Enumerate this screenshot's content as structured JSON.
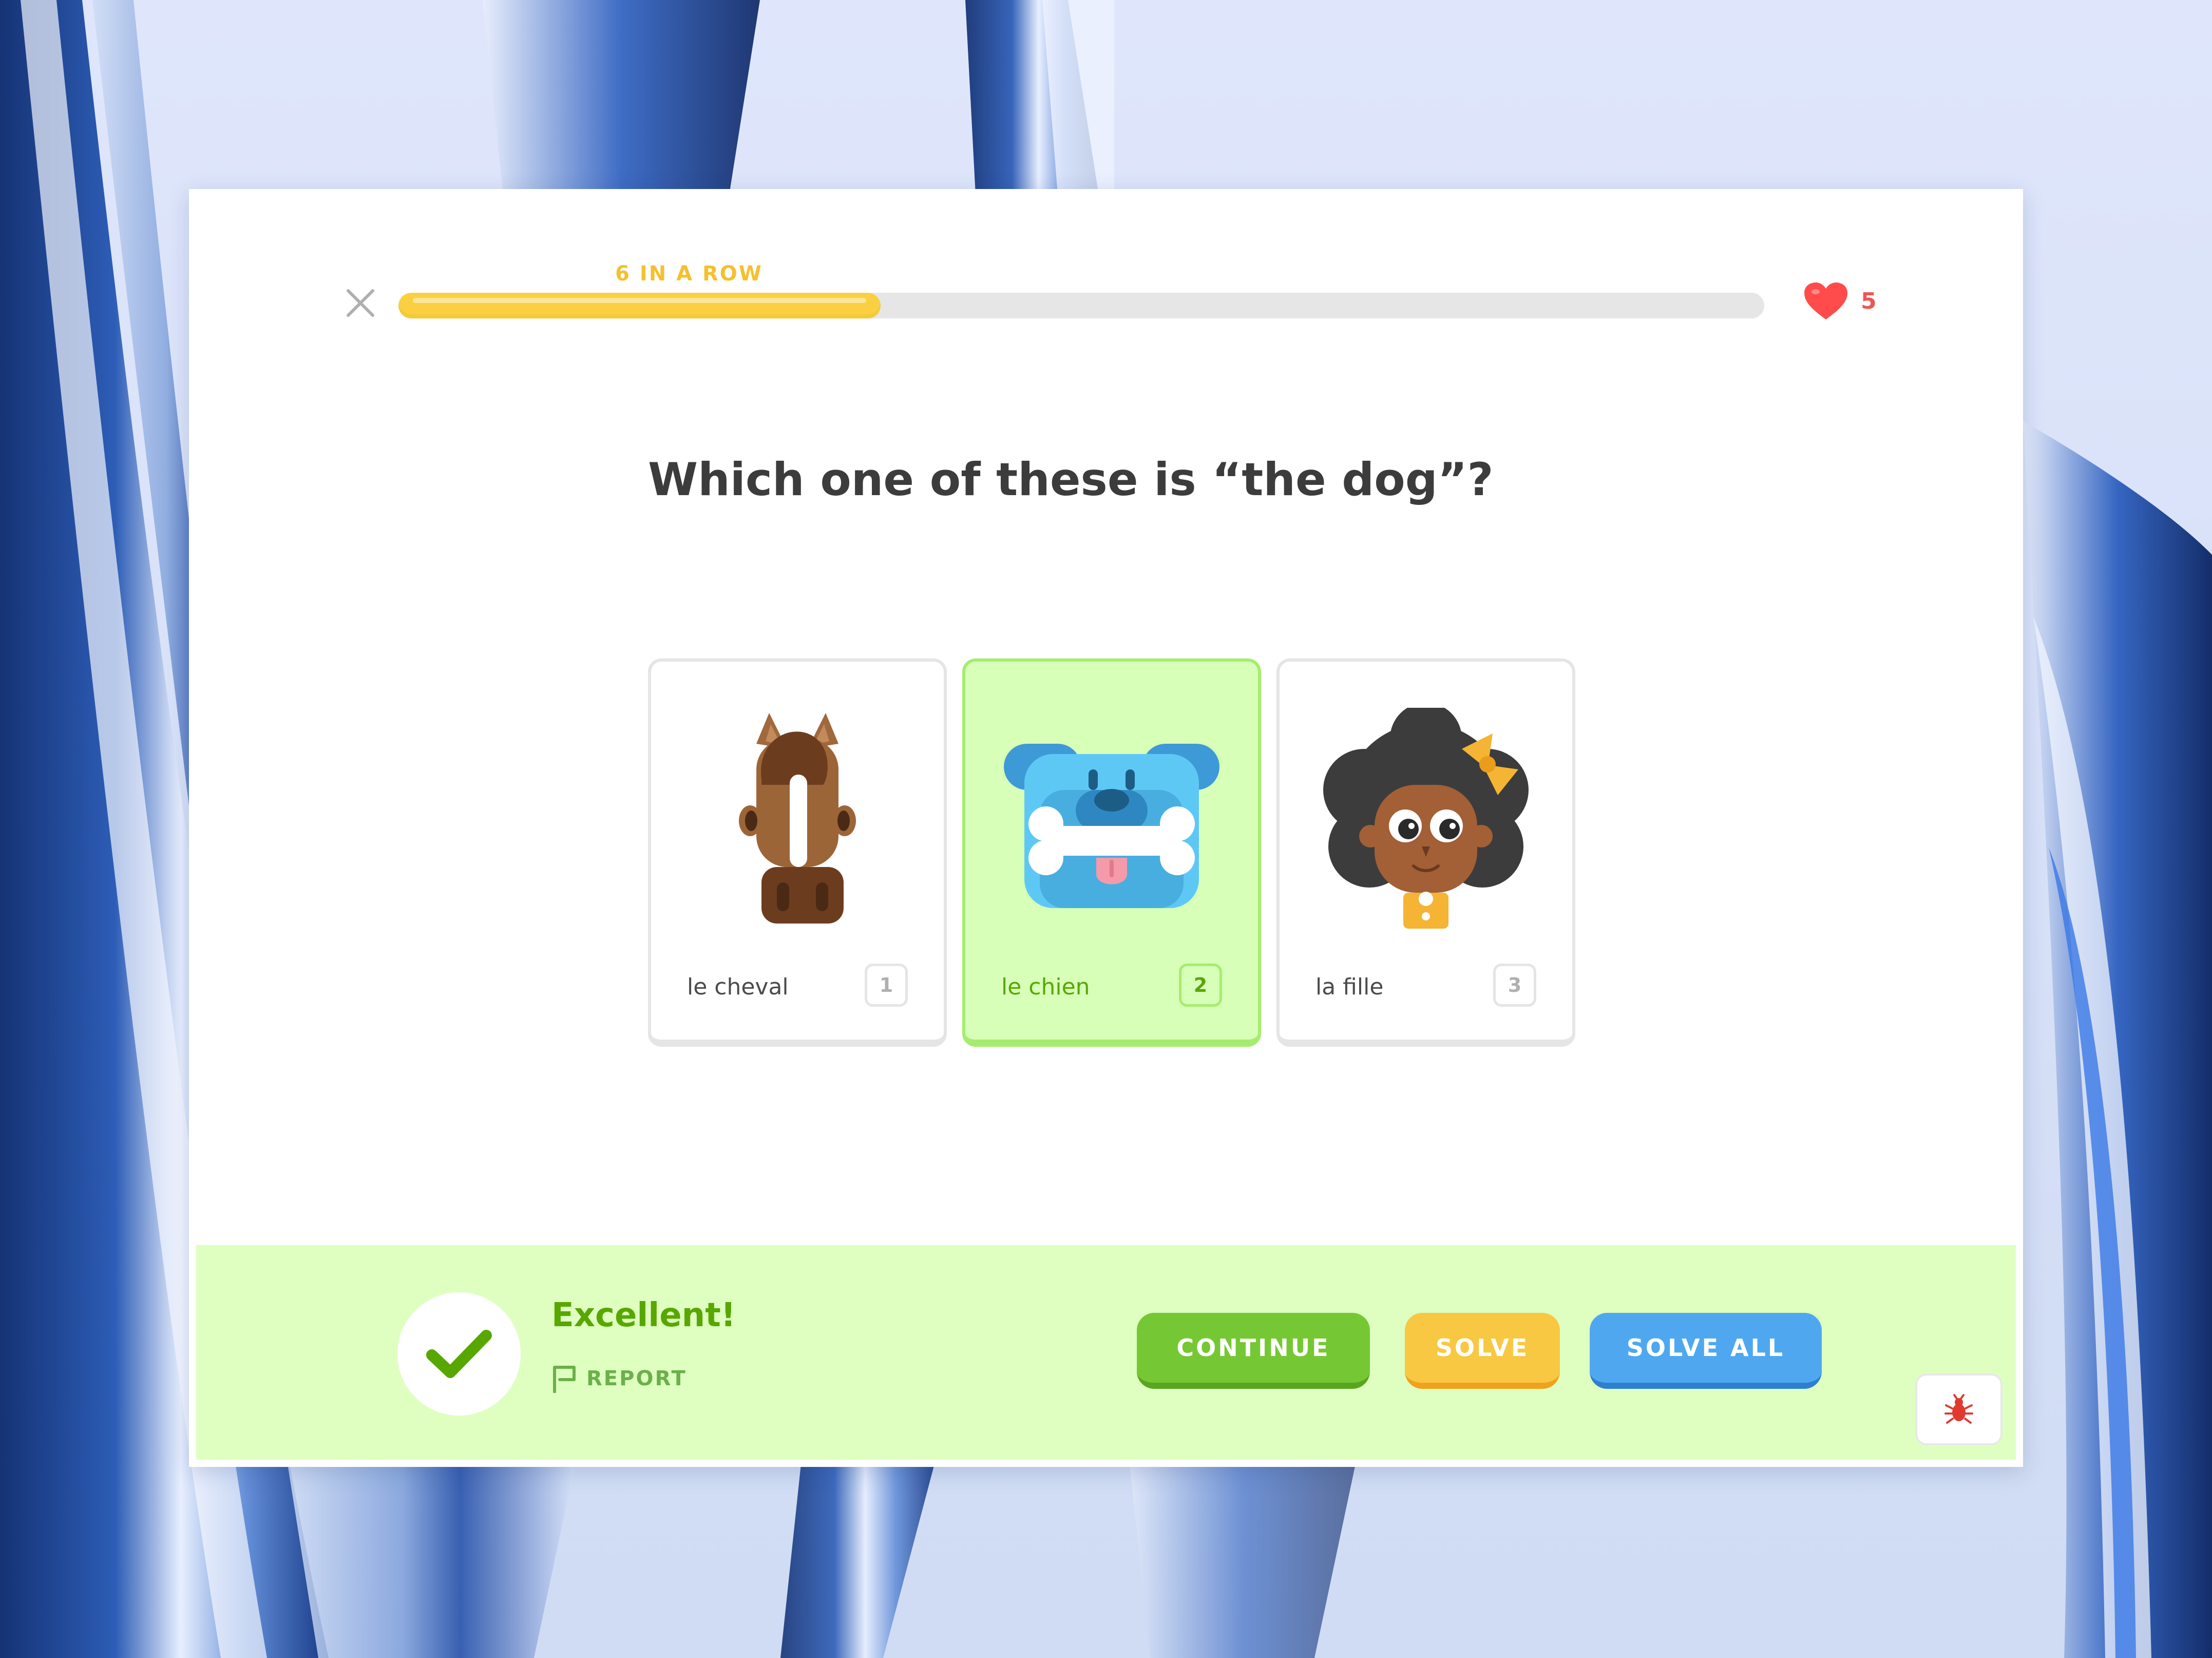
{
  "lesson": {
    "close_icon": "close-icon",
    "streak_label": "6 IN A ROW",
    "progress": 0.353,
    "hearts_icon": "heart-icon",
    "hearts_count": "5"
  },
  "question": {
    "text": "Which one of these is “the dog”?"
  },
  "choices": [
    {
      "label": "le cheval",
      "key": "1",
      "image": "horse-illustration",
      "selected": false
    },
    {
      "label": "le chien",
      "key": "2",
      "image": "dog-illustration",
      "selected": true
    },
    {
      "label": "la fille",
      "key": "3",
      "image": "girl-illustration",
      "selected": false
    }
  ],
  "feedback": {
    "icon": "checkmark-icon",
    "title": "Excellent!",
    "report_icon": "flag-icon",
    "report_label": "REPORT"
  },
  "actions": {
    "continue_label": "CONTINUE",
    "solve_label": "SOLVE",
    "solve_all_label": "SOLVE ALL",
    "debug_icon": "bug-icon"
  },
  "colors": {
    "accent_green": "#58a700",
    "selected_card_bg": "#d7ffb8",
    "footer_bg": "#dfffc0",
    "streak_yellow": "#f5c02f",
    "heart_red": "#ee5555",
    "continue_green": "#75c834",
    "solve_yellow": "#f8c843",
    "solve_all_blue": "#4fa8ef"
  }
}
